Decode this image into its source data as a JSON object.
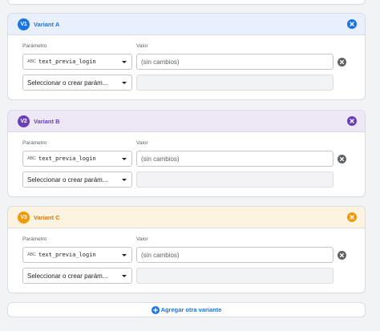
{
  "labels": {
    "parameter": "Parámetro",
    "value": "Valor"
  },
  "variants": [
    {
      "badge": "V1",
      "name": "Variant A",
      "accent": "#1a73e8",
      "header_bg": "#e8f0fe",
      "rows": [
        {
          "param_type": "ABC",
          "param": "text_previa_login",
          "value_placeholder": "(sin cambios)"
        },
        {
          "param_placeholder": "Seleccionar o crear parám..."
        }
      ]
    },
    {
      "badge": "V2",
      "name": "Variant B",
      "accent": "#6a3fb5",
      "header_bg": "#ede7f6",
      "rows": [
        {
          "param_type": "ABC",
          "param": "text_previa_login",
          "value_placeholder": "(sin cambios)"
        },
        {
          "param_placeholder": "Seleccionar o crear parám..."
        }
      ]
    },
    {
      "badge": "V3",
      "name": "Variant C",
      "accent": "#f29900",
      "header_bg": "#fef3e0",
      "rows": [
        {
          "param_type": "ABC",
          "param": "text_previa_login",
          "value_placeholder": "(sin cambios)"
        },
        {
          "param_placeholder": "Seleccionar o crear parám..."
        }
      ]
    }
  ],
  "add_variant": {
    "label": "Agregar otra variante",
    "icon": "add-circle-icon",
    "color": "#1a73e8"
  },
  "icons": {
    "close": "close-circle-icon",
    "remove": "remove-circle-icon",
    "dropdown": "caret-down-icon",
    "type": "abc-type-icon"
  }
}
